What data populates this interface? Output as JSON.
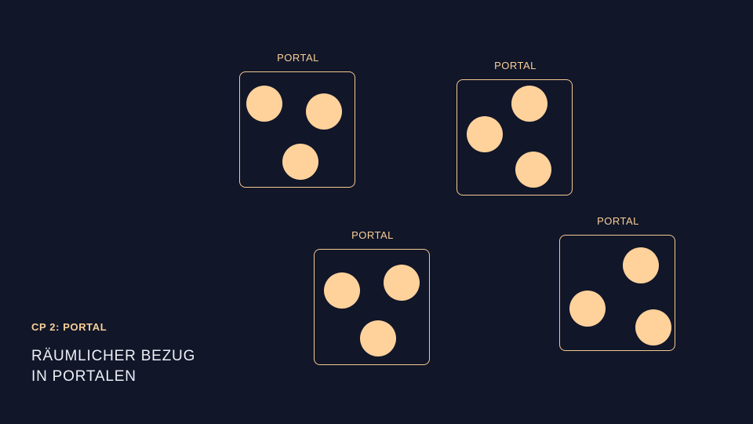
{
  "caption": {
    "kicker": "CP 2: PORTAL",
    "title_lines": [
      "RÄUMLICHER BEZUG",
      "IN PORTALEN"
    ]
  },
  "portals": [
    {
      "label": "PORTAL",
      "dots": 3
    },
    {
      "label": "PORTAL",
      "dots": 3
    },
    {
      "label": "PORTAL",
      "dots": 3
    },
    {
      "label": "PORTAL",
      "dots": 3
    }
  ],
  "colors": {
    "background": "#111629",
    "accent": "#ffd29b",
    "frame": "#f4c98f",
    "title_text": "#eef0f6"
  }
}
